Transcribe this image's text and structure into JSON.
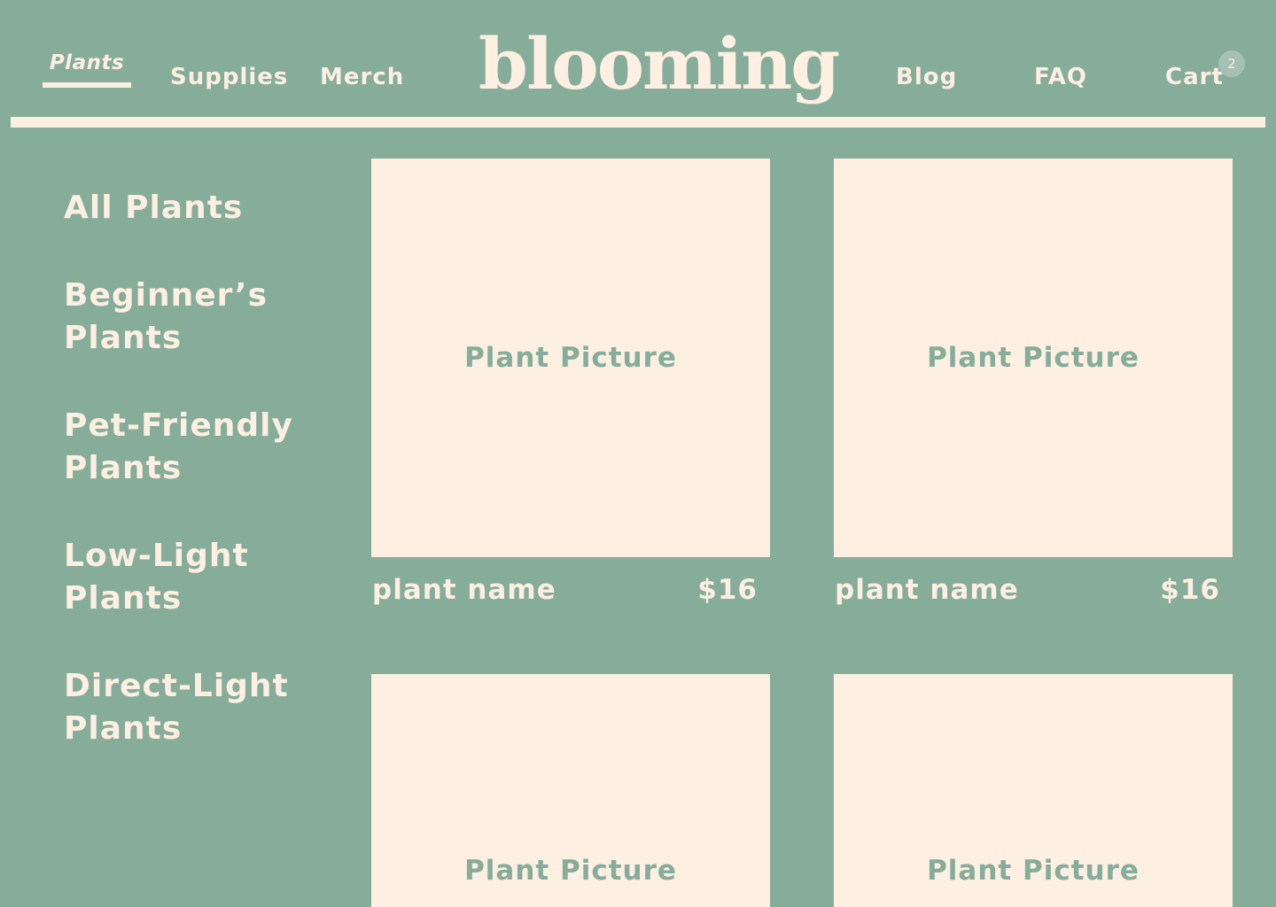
{
  "header": {
    "logo": "blooming",
    "nav_left": [
      "Plants",
      "Supplies",
      "Merch"
    ],
    "nav_right": [
      "Blog",
      "FAQ",
      "Cart"
    ],
    "cart_count": "2"
  },
  "sidebar": {
    "items": [
      "All Plants",
      "Beginner’s Plants",
      "Pet-Friendly Plants",
      "Low-Light Plants",
      "Direct-Light Plants"
    ]
  },
  "products": [
    {
      "image_label": "Plant Picture",
      "name": "plant name",
      "price": "$16"
    },
    {
      "image_label": "Plant Picture",
      "name": "plant name",
      "price": "$16"
    },
    {
      "image_label": "Plant Picture"
    },
    {
      "image_label": "Plant Picture"
    }
  ],
  "colors": {
    "background": "#86ac9a",
    "cream": "#fdefe2",
    "badge": "#a5c1b3"
  }
}
